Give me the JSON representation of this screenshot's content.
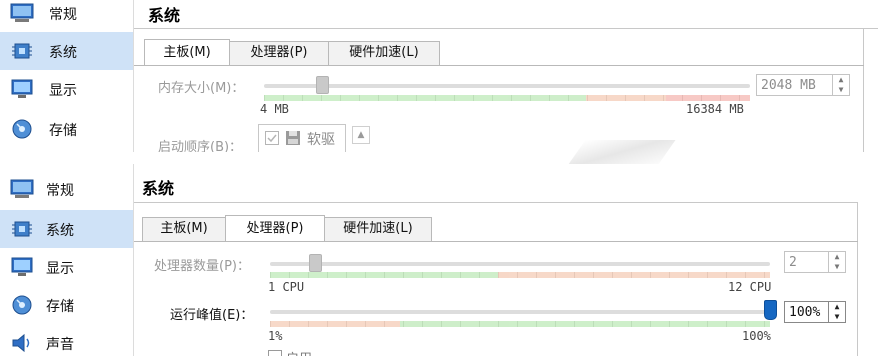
{
  "sidebar_top": [
    {
      "label": "常规",
      "icon": "monitor-icon",
      "selected": false
    },
    {
      "label": "系统",
      "icon": "chip-icon",
      "selected": true
    },
    {
      "label": "显示",
      "icon": "display-icon",
      "selected": false
    },
    {
      "label": "存储",
      "icon": "storage-icon",
      "selected": false
    }
  ],
  "sidebar_bottom": [
    {
      "label": "常规",
      "icon": "monitor-icon",
      "selected": false
    },
    {
      "label": "系统",
      "icon": "chip-icon",
      "selected": true
    },
    {
      "label": "显示",
      "icon": "display-icon",
      "selected": false
    },
    {
      "label": "存储",
      "icon": "storage-icon",
      "selected": false
    },
    {
      "label": "声音",
      "icon": "speaker-icon",
      "selected": false
    }
  ],
  "page_title": "系统",
  "tabs": [
    {
      "label": "主板(M)"
    },
    {
      "label": "处理器(P)"
    },
    {
      "label": "硬件加速(L)"
    }
  ],
  "motherboard": {
    "memory_label": "内存大小(M)：",
    "memory_value": "2048 MB",
    "memory_min": "4 MB",
    "memory_max": "16384 MB",
    "memory_fraction": 0.12,
    "boot_label": "启动顺序(B)：",
    "boot_item": "软驱"
  },
  "processor": {
    "cpu_label": "处理器数量(P)：",
    "cpu_value": "2",
    "cpu_min": "1 CPU",
    "cpu_max": "12 CPU",
    "cpu_count": 2,
    "cap_label": "运行峰值(E)：",
    "cap_value": "100%",
    "cap_min": "1%",
    "cap_max": "100%",
    "cap_percent": 100,
    "pae_text": "启用"
  },
  "colors": {
    "selected_bg": "#cfe2f7",
    "bar_green": "#c6ecc1",
    "bar_orange": "#f6d2bf",
    "bar_red": "#f6c0bb",
    "knob_blue": "#1567c2"
  }
}
